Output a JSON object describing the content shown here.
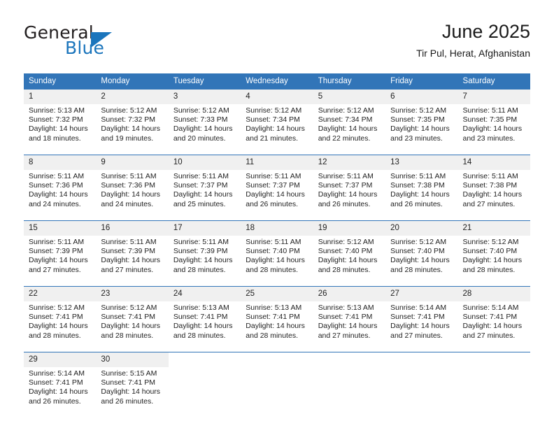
{
  "brand": {
    "name_part1": "General",
    "name_part2": "Blue",
    "triangle_color": "#1b75bc",
    "text_color": "#231f20"
  },
  "header": {
    "title": "June 2025",
    "subtitle": "Tir Pul, Herat, Afghanistan"
  },
  "theme": {
    "header_blue": "#3275b8",
    "daynum_band": "#f0f0f0",
    "text": "#222222"
  },
  "calendar": {
    "day_headers": [
      "Sunday",
      "Monday",
      "Tuesday",
      "Wednesday",
      "Thursday",
      "Friday",
      "Saturday"
    ],
    "weeks": [
      [
        {
          "day": "1",
          "sunrise": "Sunrise: 5:13 AM",
          "sunset": "Sunset: 7:32 PM",
          "daylight_line1": "Daylight: 14 hours",
          "daylight_line2": "and 18 minutes."
        },
        {
          "day": "2",
          "sunrise": "Sunrise: 5:12 AM",
          "sunset": "Sunset: 7:32 PM",
          "daylight_line1": "Daylight: 14 hours",
          "daylight_line2": "and 19 minutes."
        },
        {
          "day": "3",
          "sunrise": "Sunrise: 5:12 AM",
          "sunset": "Sunset: 7:33 PM",
          "daylight_line1": "Daylight: 14 hours",
          "daylight_line2": "and 20 minutes."
        },
        {
          "day": "4",
          "sunrise": "Sunrise: 5:12 AM",
          "sunset": "Sunset: 7:34 PM",
          "daylight_line1": "Daylight: 14 hours",
          "daylight_line2": "and 21 minutes."
        },
        {
          "day": "5",
          "sunrise": "Sunrise: 5:12 AM",
          "sunset": "Sunset: 7:34 PM",
          "daylight_line1": "Daylight: 14 hours",
          "daylight_line2": "and 22 minutes."
        },
        {
          "day": "6",
          "sunrise": "Sunrise: 5:12 AM",
          "sunset": "Sunset: 7:35 PM",
          "daylight_line1": "Daylight: 14 hours",
          "daylight_line2": "and 23 minutes."
        },
        {
          "day": "7",
          "sunrise": "Sunrise: 5:11 AM",
          "sunset": "Sunset: 7:35 PM",
          "daylight_line1": "Daylight: 14 hours",
          "daylight_line2": "and 23 minutes."
        }
      ],
      [
        {
          "day": "8",
          "sunrise": "Sunrise: 5:11 AM",
          "sunset": "Sunset: 7:36 PM",
          "daylight_line1": "Daylight: 14 hours",
          "daylight_line2": "and 24 minutes."
        },
        {
          "day": "9",
          "sunrise": "Sunrise: 5:11 AM",
          "sunset": "Sunset: 7:36 PM",
          "daylight_line1": "Daylight: 14 hours",
          "daylight_line2": "and 24 minutes."
        },
        {
          "day": "10",
          "sunrise": "Sunrise: 5:11 AM",
          "sunset": "Sunset: 7:37 PM",
          "daylight_line1": "Daylight: 14 hours",
          "daylight_line2": "and 25 minutes."
        },
        {
          "day": "11",
          "sunrise": "Sunrise: 5:11 AM",
          "sunset": "Sunset: 7:37 PM",
          "daylight_line1": "Daylight: 14 hours",
          "daylight_line2": "and 26 minutes."
        },
        {
          "day": "12",
          "sunrise": "Sunrise: 5:11 AM",
          "sunset": "Sunset: 7:37 PM",
          "daylight_line1": "Daylight: 14 hours",
          "daylight_line2": "and 26 minutes."
        },
        {
          "day": "13",
          "sunrise": "Sunrise: 5:11 AM",
          "sunset": "Sunset: 7:38 PM",
          "daylight_line1": "Daylight: 14 hours",
          "daylight_line2": "and 26 minutes."
        },
        {
          "day": "14",
          "sunrise": "Sunrise: 5:11 AM",
          "sunset": "Sunset: 7:38 PM",
          "daylight_line1": "Daylight: 14 hours",
          "daylight_line2": "and 27 minutes."
        }
      ],
      [
        {
          "day": "15",
          "sunrise": "Sunrise: 5:11 AM",
          "sunset": "Sunset: 7:39 PM",
          "daylight_line1": "Daylight: 14 hours",
          "daylight_line2": "and 27 minutes."
        },
        {
          "day": "16",
          "sunrise": "Sunrise: 5:11 AM",
          "sunset": "Sunset: 7:39 PM",
          "daylight_line1": "Daylight: 14 hours",
          "daylight_line2": "and 27 minutes."
        },
        {
          "day": "17",
          "sunrise": "Sunrise: 5:11 AM",
          "sunset": "Sunset: 7:39 PM",
          "daylight_line1": "Daylight: 14 hours",
          "daylight_line2": "and 28 minutes."
        },
        {
          "day": "18",
          "sunrise": "Sunrise: 5:11 AM",
          "sunset": "Sunset: 7:40 PM",
          "daylight_line1": "Daylight: 14 hours",
          "daylight_line2": "and 28 minutes."
        },
        {
          "day": "19",
          "sunrise": "Sunrise: 5:12 AM",
          "sunset": "Sunset: 7:40 PM",
          "daylight_line1": "Daylight: 14 hours",
          "daylight_line2": "and 28 minutes."
        },
        {
          "day": "20",
          "sunrise": "Sunrise: 5:12 AM",
          "sunset": "Sunset: 7:40 PM",
          "daylight_line1": "Daylight: 14 hours",
          "daylight_line2": "and 28 minutes."
        },
        {
          "day": "21",
          "sunrise": "Sunrise: 5:12 AM",
          "sunset": "Sunset: 7:40 PM",
          "daylight_line1": "Daylight: 14 hours",
          "daylight_line2": "and 28 minutes."
        }
      ],
      [
        {
          "day": "22",
          "sunrise": "Sunrise: 5:12 AM",
          "sunset": "Sunset: 7:41 PM",
          "daylight_line1": "Daylight: 14 hours",
          "daylight_line2": "and 28 minutes."
        },
        {
          "day": "23",
          "sunrise": "Sunrise: 5:12 AM",
          "sunset": "Sunset: 7:41 PM",
          "daylight_line1": "Daylight: 14 hours",
          "daylight_line2": "and 28 minutes."
        },
        {
          "day": "24",
          "sunrise": "Sunrise: 5:13 AM",
          "sunset": "Sunset: 7:41 PM",
          "daylight_line1": "Daylight: 14 hours",
          "daylight_line2": "and 28 minutes."
        },
        {
          "day": "25",
          "sunrise": "Sunrise: 5:13 AM",
          "sunset": "Sunset: 7:41 PM",
          "daylight_line1": "Daylight: 14 hours",
          "daylight_line2": "and 28 minutes."
        },
        {
          "day": "26",
          "sunrise": "Sunrise: 5:13 AM",
          "sunset": "Sunset: 7:41 PM",
          "daylight_line1": "Daylight: 14 hours",
          "daylight_line2": "and 27 minutes."
        },
        {
          "day": "27",
          "sunrise": "Sunrise: 5:14 AM",
          "sunset": "Sunset: 7:41 PM",
          "daylight_line1": "Daylight: 14 hours",
          "daylight_line2": "and 27 minutes."
        },
        {
          "day": "28",
          "sunrise": "Sunrise: 5:14 AM",
          "sunset": "Sunset: 7:41 PM",
          "daylight_line1": "Daylight: 14 hours",
          "daylight_line2": "and 27 minutes."
        }
      ],
      [
        {
          "day": "29",
          "sunrise": "Sunrise: 5:14 AM",
          "sunset": "Sunset: 7:41 PM",
          "daylight_line1": "Daylight: 14 hours",
          "daylight_line2": "and 26 minutes."
        },
        {
          "day": "30",
          "sunrise": "Sunrise: 5:15 AM",
          "sunset": "Sunset: 7:41 PM",
          "daylight_line1": "Daylight: 14 hours",
          "daylight_line2": "and 26 minutes."
        },
        {
          "day": "",
          "sunrise": "",
          "sunset": "",
          "daylight_line1": "",
          "daylight_line2": ""
        },
        {
          "day": "",
          "sunrise": "",
          "sunset": "",
          "daylight_line1": "",
          "daylight_line2": ""
        },
        {
          "day": "",
          "sunrise": "",
          "sunset": "",
          "daylight_line1": "",
          "daylight_line2": ""
        },
        {
          "day": "",
          "sunrise": "",
          "sunset": "",
          "daylight_line1": "",
          "daylight_line2": ""
        },
        {
          "day": "",
          "sunrise": "",
          "sunset": "",
          "daylight_line1": "",
          "daylight_line2": ""
        }
      ]
    ]
  }
}
